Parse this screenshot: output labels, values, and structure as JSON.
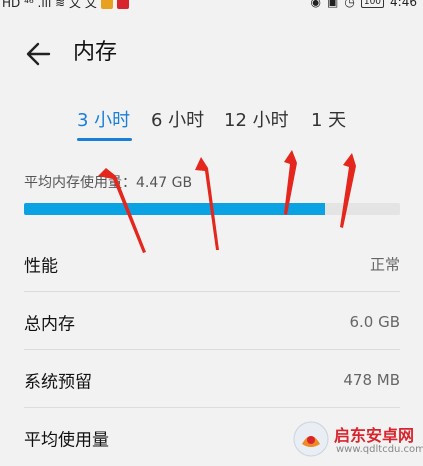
{
  "status_bar": {
    "left_text": "HD ⁴⁶ .ıll ≋ 文 文",
    "right_battery": "100",
    "time": "4:46"
  },
  "header": {
    "back_icon": "arrow-left-icon",
    "title": "内存"
  },
  "tabs": [
    {
      "label": "3 小时",
      "active": true
    },
    {
      "label": "6 小时",
      "active": false
    },
    {
      "label": "12 小时",
      "active": false
    },
    {
      "label": "1 天",
      "active": false
    }
  ],
  "average": {
    "label": "平均内存使用量：4.47 GB",
    "usage_fraction": 0.8
  },
  "rows": [
    {
      "label": "性能",
      "value": "正常"
    },
    {
      "label": "总内存",
      "value": "6.0 GB"
    },
    {
      "label": "系统预留",
      "value": "478 MB"
    },
    {
      "label": "平均使用量",
      "value": ""
    }
  ],
  "colors": {
    "accent": "#1a7fd8",
    "progress_fill": "#0aa2e3",
    "annotation": "#e5261c"
  },
  "watermark": {
    "name": "启东安卓网",
    "url": "www.qdltcdu.com"
  }
}
